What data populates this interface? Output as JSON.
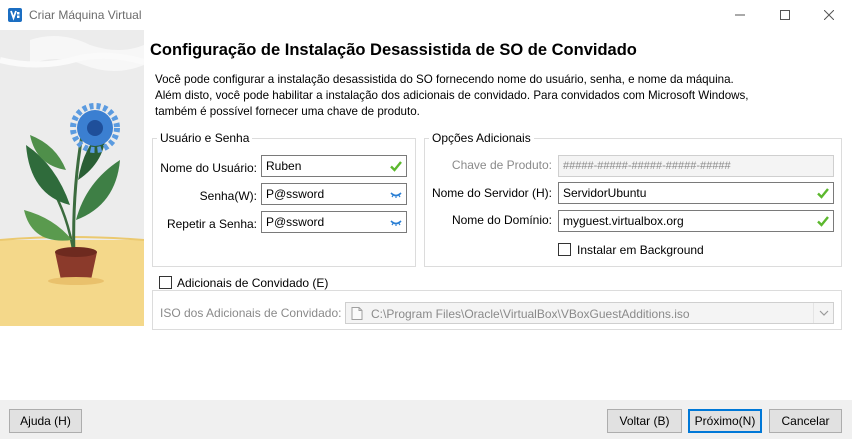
{
  "window": {
    "title": "Criar Máquina Virtual"
  },
  "page": {
    "title": "Configuração de Instalação Desassistida de SO de Convidado",
    "description_lines": [
      "Você pode configurar a instalação desassistida do SO fornecendo nome do usuário, senha, e nome da máquina.",
      "Além disto, você pode habilitar a instalação dos adicionais de convidado. Para convidados com Microsoft Windows,",
      "também é possível fornecer uma chave de produto."
    ]
  },
  "user_group": {
    "title": "Usuário e Senha",
    "username": {
      "label": "Nome do Usuário:",
      "value": "Ruben"
    },
    "password": {
      "label": "Senha(W):",
      "value": "P@ssword"
    },
    "repeat_password": {
      "label": "Repetir a Senha:",
      "value": "P@ssword"
    }
  },
  "options_group": {
    "title": "Opções Adicionais",
    "product_key": {
      "label": "Chave de Produto:",
      "placeholder": "#####-#####-#####-#####-#####"
    },
    "hostname": {
      "label": "Nome do Servidor (H):",
      "value": "ServidorUbuntu"
    },
    "domain": {
      "label": "Nome do Domínio:",
      "value": "myguest.virtualbox.org"
    },
    "background": {
      "label": "Instalar em Background",
      "checked": false
    }
  },
  "guest_additions": {
    "label": "Adicionais de Convidado (E)",
    "checked": false,
    "iso_label": "ISO dos Adicionais de Convidado:",
    "iso_path": "C:\\Program Files\\Oracle\\VirtualBox\\VBoxGuestAdditions.iso"
  },
  "buttons": {
    "help": "Ajuda (H)",
    "back": "Voltar (B)",
    "next": "Próximo(N)",
    "cancel": "Cancelar"
  },
  "colors": {
    "valid_check": "#5cb82e",
    "password_eye": "#2a7fd4",
    "floor": "#f4d88a",
    "pot": "#8b3a2b",
    "flower": "#3b7fd1"
  },
  "icons": [
    "virtualbox-app-icon",
    "minimize-icon",
    "maximize-icon",
    "close-icon",
    "check-icon",
    "eye-icon",
    "file-icon",
    "chevron-down-icon"
  ]
}
